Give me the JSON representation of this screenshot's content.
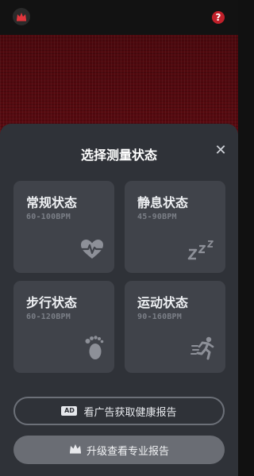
{
  "header": {
    "left_icon": "crown-icon",
    "right_icon": "help-icon",
    "help_glyph": "?"
  },
  "sheet": {
    "title": "选择测量状态",
    "close_glyph": "✕"
  },
  "states": [
    {
      "label": "常规状态",
      "range": "60-100BPM",
      "icon": "heart-pulse-icon"
    },
    {
      "label": "静息状态",
      "range": "45-90BPM",
      "icon": "sleep-zzz-icon"
    },
    {
      "label": "步行状态",
      "range": "60-120BPM",
      "icon": "footprint-icon"
    },
    {
      "label": "运动状态",
      "range": "90-160BPM",
      "icon": "running-icon"
    }
  ],
  "actions": {
    "ad_badge": "AD",
    "ad_label": "看广告获取健康报告",
    "upgrade_label": "升级查看专业报告"
  },
  "colors": {
    "hero": "#5a0a10",
    "sheet": "#2f3238",
    "card": "#40434a",
    "accent_red": "#c0202a"
  }
}
